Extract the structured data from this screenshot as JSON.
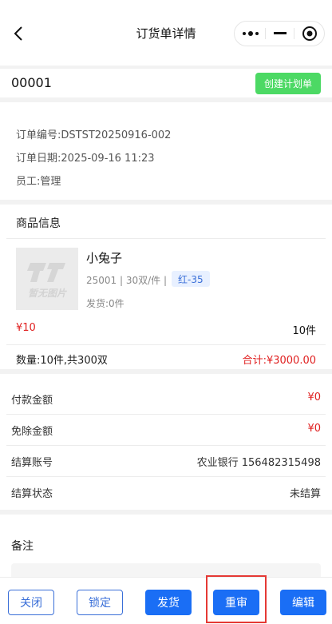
{
  "header": {
    "title": "订货单详情",
    "back_icon": "chevron-left-icon",
    "capsule": {
      "more_icon": "dots-icon",
      "minimize_icon": "minus-icon",
      "close_icon": "target-icon"
    }
  },
  "order": {
    "code": "00001",
    "create_plan_label": "创建计划单",
    "number_line": "订单编号:DSTST20250916-002",
    "date_line": "订单日期:2025-09-16 11:23",
    "staff_line": "员工:管理"
  },
  "goods": {
    "section_title": "商品信息",
    "placeholder_text": "暂无图片",
    "name": "小兔子",
    "meta": "25001 | 30双/件 |",
    "tag": "红-35",
    "shipped": "发货:0件",
    "price": "¥10",
    "count": "10件",
    "summary": "数量:10件,共300双",
    "total": "合计:¥3000.00"
  },
  "payment": {
    "rows": [
      {
        "label": "付款金额",
        "value": "¥0"
      },
      {
        "label": "免除金额",
        "value": "¥0"
      },
      {
        "label": "结算账号",
        "value": "农业银行 156482315498"
      },
      {
        "label": "结算状态",
        "value": "未结算"
      }
    ]
  },
  "remark": {
    "title": "备注"
  },
  "actions": {
    "close": "关闭",
    "lock": "锁定",
    "ship": "发货",
    "review": "重审",
    "edit": "编辑"
  },
  "colors": {
    "accent": "#1a6ef5",
    "green": "#4cd964",
    "red": "#e02020",
    "highlight": "#e53935"
  }
}
